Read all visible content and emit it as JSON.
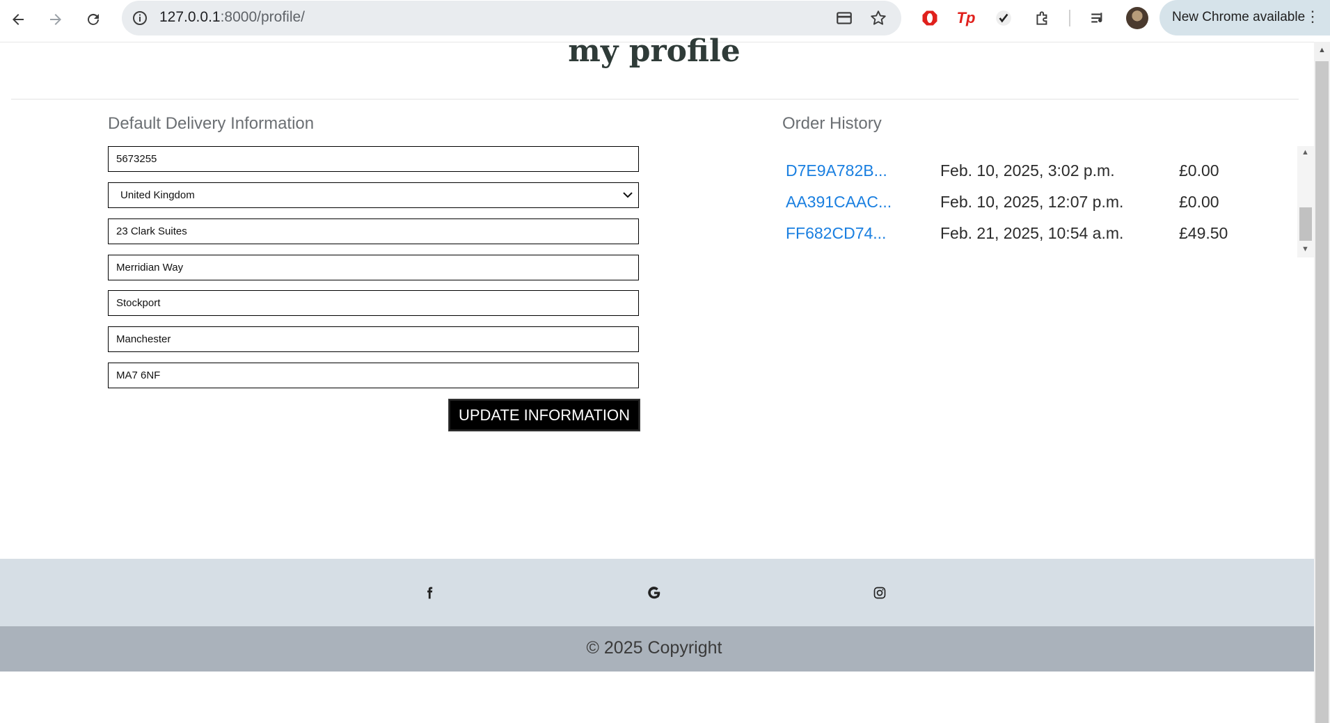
{
  "browser": {
    "url_host": "127.0.0.1",
    "url_path": ":8000/profile/",
    "new_chrome_label": "New Chrome available",
    "icons": [
      "back-arrow-icon",
      "forward-arrow-icon",
      "reload-icon",
      "site-info-icon",
      "card-icon",
      "bookmark-star-icon",
      "opera-extension-icon",
      "tp-extension-icon",
      "check-extension-icon",
      "puzzle-extensions-icon",
      "media-queue-icon",
      "avatar",
      "kebab-menu-icon"
    ]
  },
  "page": {
    "title": "my profile"
  },
  "delivery": {
    "heading": "Default Delivery Information",
    "phone": "5673255",
    "country": "United Kingdom",
    "address1": "23 Clark Suites",
    "address2": "Merridian Way",
    "town": "Stockport",
    "county": "Manchester",
    "postcode": "MA7 6NF",
    "update_button": "UPDATE INFORMATION"
  },
  "orders": {
    "heading": "Order History",
    "rows": [
      {
        "number": "D7E9A782B...",
        "date": "Feb. 10, 2025, 3:02 p.m.",
        "total": "£0.00"
      },
      {
        "number": "AA391CAAC...",
        "date": "Feb. 10, 2025, 12:07 p.m.",
        "total": "£0.00"
      },
      {
        "number": "FF682CD74...",
        "date": "Feb. 21, 2025, 10:54 a.m.",
        "total": "£49.50"
      }
    ]
  },
  "footer": {
    "social": [
      "facebook-icon",
      "google-icon",
      "instagram-icon"
    ],
    "copyright": "© 2025 Copyright"
  },
  "colors": {
    "link": "#1a7fe0",
    "footer_light": "#d6dee5",
    "footer_dark": "#aab2bb",
    "button_bg": "#000000"
  }
}
